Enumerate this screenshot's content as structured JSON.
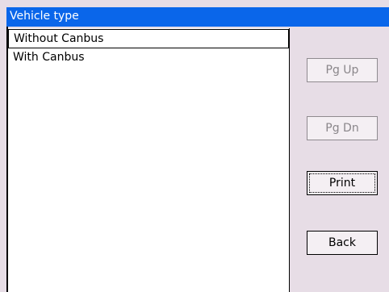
{
  "window": {
    "title": "Vehicle type"
  },
  "list": {
    "items": [
      {
        "label": "Without Canbus",
        "selected": true
      },
      {
        "label": "With Canbus",
        "selected": false
      }
    ]
  },
  "buttons": {
    "page_up": {
      "label": "Pg Up",
      "enabled": false
    },
    "page_down": {
      "label": "Pg Dn",
      "enabled": false
    },
    "print": {
      "label": "Print",
      "enabled": true,
      "focused": true
    },
    "back": {
      "label": "Back",
      "enabled": true
    }
  },
  "colors": {
    "title_bar": "#0a66ea",
    "background": "#e7dde6",
    "list_background": "#ffffff",
    "disabled_text": "#8a868a"
  }
}
